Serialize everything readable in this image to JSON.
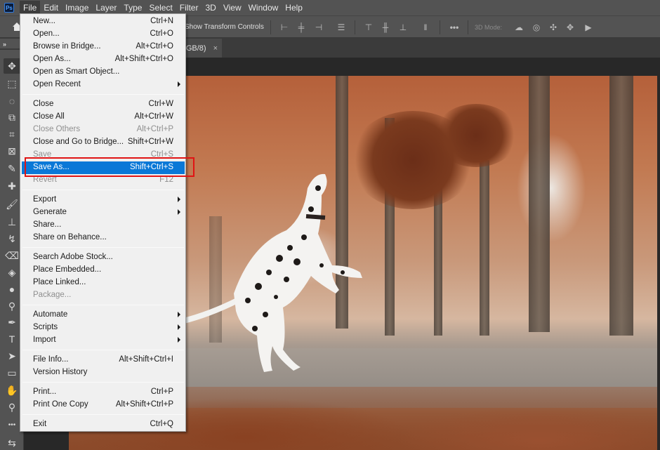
{
  "app": {
    "logo": "Ps"
  },
  "menubar": {
    "items": [
      {
        "label": "File",
        "active": true
      },
      {
        "label": "Edit"
      },
      {
        "label": "Image"
      },
      {
        "label": "Layer"
      },
      {
        "label": "Type"
      },
      {
        "label": "Select"
      },
      {
        "label": "Filter"
      },
      {
        "label": "3D"
      },
      {
        "label": "View"
      },
      {
        "label": "Window"
      },
      {
        "label": "Help"
      }
    ]
  },
  "options_bar": {
    "show_transform_controls": "Show Transform Controls",
    "mode_label": "3D Mode:",
    "more_icon": "more-options-icon"
  },
  "tabs": [
    {
      "title": "GB/8)",
      "close": "×"
    }
  ],
  "toolbar": {
    "collapse": "»",
    "tools": [
      {
        "name": "move-tool",
        "glyph": "✥",
        "selected": true
      },
      {
        "name": "marquee-tool",
        "glyph": "⬚"
      },
      {
        "name": "lasso-tool",
        "glyph": "◌"
      },
      {
        "name": "object-select-tool",
        "glyph": "⧉"
      },
      {
        "name": "crop-tool",
        "glyph": "⌗"
      },
      {
        "name": "frame-tool",
        "glyph": "⊠"
      },
      {
        "name": "eyedropper-tool",
        "glyph": "✎"
      },
      {
        "name": "healing-brush-tool",
        "glyph": "✚"
      },
      {
        "name": "brush-tool",
        "glyph": "🖌"
      },
      {
        "name": "clone-stamp-tool",
        "glyph": "⊥"
      },
      {
        "name": "history-brush-tool",
        "glyph": "↯"
      },
      {
        "name": "eraser-tool",
        "glyph": "⌫"
      },
      {
        "name": "paint-bucket-tool",
        "glyph": "◈"
      },
      {
        "name": "blur-tool",
        "glyph": "●"
      },
      {
        "name": "dodge-tool",
        "glyph": "⚲"
      },
      {
        "name": "pen-tool",
        "glyph": "✒"
      },
      {
        "name": "type-tool",
        "glyph": "T"
      },
      {
        "name": "path-selection-tool",
        "glyph": "➤"
      },
      {
        "name": "rectangle-tool",
        "glyph": "▭"
      },
      {
        "name": "hand-tool",
        "glyph": "✋"
      },
      {
        "name": "zoom-tool",
        "glyph": "⚲"
      },
      {
        "name": "edit-toolbar",
        "glyph": "•••"
      },
      {
        "name": "swap-colors",
        "glyph": "⇆"
      }
    ]
  },
  "file_menu": {
    "rows": [
      {
        "type": "item",
        "label": "New...",
        "shortcut": "Ctrl+N"
      },
      {
        "type": "item",
        "label": "Open...",
        "shortcut": "Ctrl+O"
      },
      {
        "type": "item",
        "label": "Browse in Bridge...",
        "shortcut": "Alt+Ctrl+O"
      },
      {
        "type": "item",
        "label": "Open As...",
        "shortcut": "Alt+Shift+Ctrl+O"
      },
      {
        "type": "item",
        "label": "Open as Smart Object...",
        "shortcut": ""
      },
      {
        "type": "item",
        "label": "Open Recent",
        "shortcut": "",
        "submenu": true
      },
      {
        "type": "sep"
      },
      {
        "type": "item",
        "label": "Close",
        "shortcut": "Ctrl+W"
      },
      {
        "type": "item",
        "label": "Close All",
        "shortcut": "Alt+Ctrl+W"
      },
      {
        "type": "item",
        "label": "Close Others",
        "shortcut": "Alt+Ctrl+P",
        "disabled": true
      },
      {
        "type": "item",
        "label": "Close and Go to Bridge...",
        "shortcut": "Shift+Ctrl+W"
      },
      {
        "type": "item",
        "label": "Save",
        "shortcut": "Ctrl+S",
        "disabled": true
      },
      {
        "type": "item",
        "label": "Save As...",
        "shortcut": "Shift+Ctrl+S",
        "highlight": true
      },
      {
        "type": "item",
        "label": "Revert",
        "shortcut": "F12",
        "disabled": true
      },
      {
        "type": "sep"
      },
      {
        "type": "item",
        "label": "Export",
        "shortcut": "",
        "submenu": true
      },
      {
        "type": "item",
        "label": "Generate",
        "shortcut": "",
        "submenu": true
      },
      {
        "type": "item",
        "label": "Share...",
        "shortcut": ""
      },
      {
        "type": "item",
        "label": "Share on Behance...",
        "shortcut": ""
      },
      {
        "type": "sep"
      },
      {
        "type": "item",
        "label": "Search Adobe Stock...",
        "shortcut": ""
      },
      {
        "type": "item",
        "label": "Place Embedded...",
        "shortcut": ""
      },
      {
        "type": "item",
        "label": "Place Linked...",
        "shortcut": ""
      },
      {
        "type": "item",
        "label": "Package...",
        "shortcut": "",
        "disabled": true
      },
      {
        "type": "sep"
      },
      {
        "type": "item",
        "label": "Automate",
        "shortcut": "",
        "submenu": true
      },
      {
        "type": "item",
        "label": "Scripts",
        "shortcut": "",
        "submenu": true
      },
      {
        "type": "item",
        "label": "Import",
        "shortcut": "",
        "submenu": true
      },
      {
        "type": "sep"
      },
      {
        "type": "item",
        "label": "File Info...",
        "shortcut": "Alt+Shift+Ctrl+I"
      },
      {
        "type": "item",
        "label": "Version History",
        "shortcut": ""
      },
      {
        "type": "sep"
      },
      {
        "type": "item",
        "label": "Print...",
        "shortcut": "Ctrl+P"
      },
      {
        "type": "item",
        "label": "Print One Copy",
        "shortcut": "Alt+Shift+Ctrl+P"
      },
      {
        "type": "sep"
      },
      {
        "type": "item",
        "label": "Exit",
        "shortcut": "Ctrl+Q"
      }
    ]
  },
  "annotation": {
    "target": "Save As...",
    "color": "#e01414"
  },
  "colors": {
    "highlight": "#0a78d7",
    "menu_bg": "#f0f0f0",
    "chrome": "#535353",
    "canvas_bg": "#282828"
  }
}
